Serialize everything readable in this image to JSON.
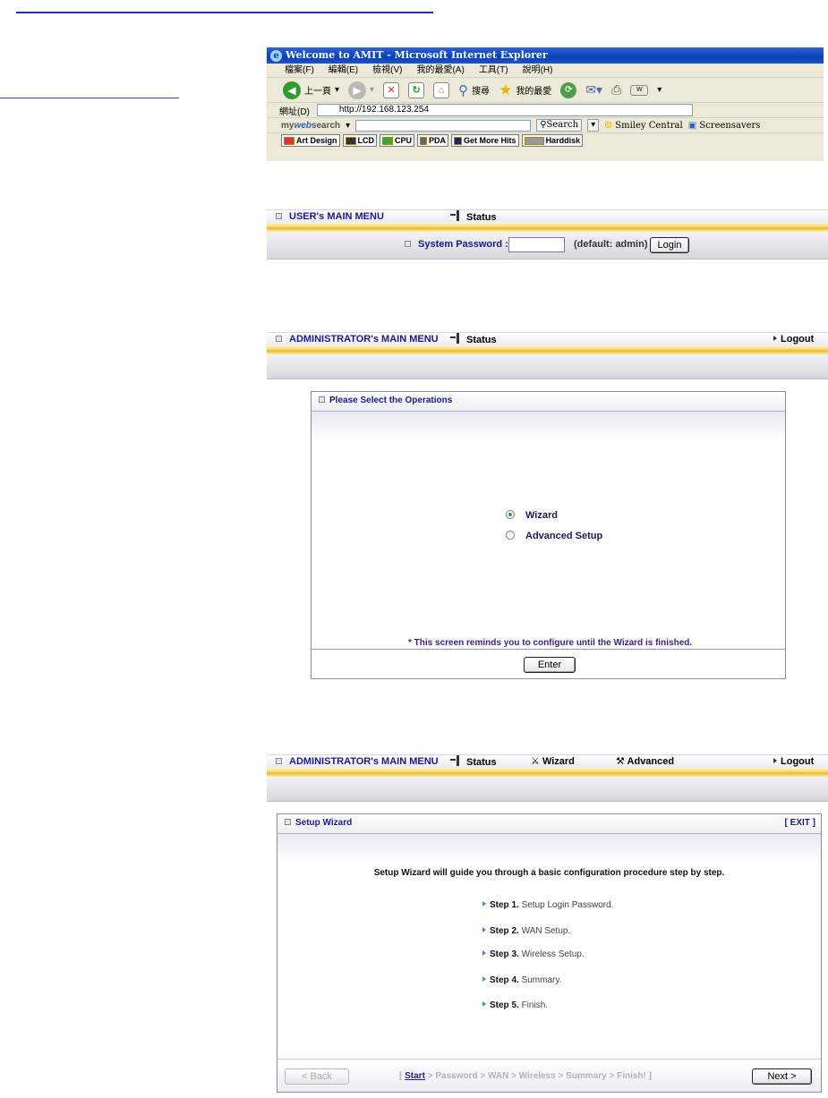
{
  "browser": {
    "title": "Welcome to AMIT - Microsoft Internet Explorer",
    "menu": [
      "檔案(F)",
      "編輯(E)",
      "檢視(V)",
      "我的最愛(A)",
      "工具(T)",
      "說明(H)"
    ],
    "toolbar": {
      "back": "上一頁",
      "search": "搜尋",
      "favorites": "我的最愛"
    },
    "address_label": "網址(D)",
    "address": "http://192.168.123.254",
    "search_bar": {
      "brand_prefix": "my",
      "brand_mid": "web",
      "brand_suffix": "search",
      "search_button": "Search",
      "smiley": "Smiley Central",
      "screensavers": "Screensavers"
    },
    "links": [
      "Art Design",
      "LCD",
      "CPU",
      "PDA",
      "Get More Hits",
      "Harddisk"
    ]
  },
  "user_menu": {
    "title": "USER's MAIN MENU",
    "status": "Status",
    "password_label": "System Password :",
    "password_value": "",
    "default_hint": "(default: admin)",
    "login_button": "Login"
  },
  "admin_menu": {
    "title": "ADMINISTRATOR's MAIN MENU",
    "status": "Status",
    "logout": "Logout"
  },
  "operations": {
    "header": "Please Select the Operations",
    "options": [
      "Wizard",
      "Advanced Setup"
    ],
    "selected": "Wizard",
    "note": "* This screen reminds you to configure until the Wizard is finished.",
    "enter_button": "Enter"
  },
  "admin_menu2": {
    "title": "ADMINISTRATOR's MAIN MENU",
    "status": "Status",
    "wizard": "Wizard",
    "advanced": "Advanced",
    "logout": "Logout"
  },
  "wizard": {
    "header": "Setup Wizard",
    "exit": "[ EXIT ]",
    "intro": "Setup Wizard will guide you through a basic configuration procedure step by step.",
    "steps": [
      {
        "label": "Step 1.",
        "text": "Setup Login Password."
      },
      {
        "label": "Step 2.",
        "text": "WAN Setup."
      },
      {
        "label": "Step 3.",
        "text": "Wireless Setup."
      },
      {
        "label": "Step 4.",
        "text": "Summary."
      },
      {
        "label": "Step 5.",
        "text": "Finish."
      }
    ],
    "back_button": "< Back",
    "next_button": "Next >",
    "breadcrumb": {
      "open": "[",
      "current": "Start",
      "rest": "> Password > WAN > Wireless > Summary > Finish!",
      "close": "]"
    }
  },
  "colors": {
    "menu_text": "#1a1a8a",
    "link_blue": "#2b2bd4",
    "gold": "#f3d86a",
    "note_text": "#3a1f8a"
  }
}
